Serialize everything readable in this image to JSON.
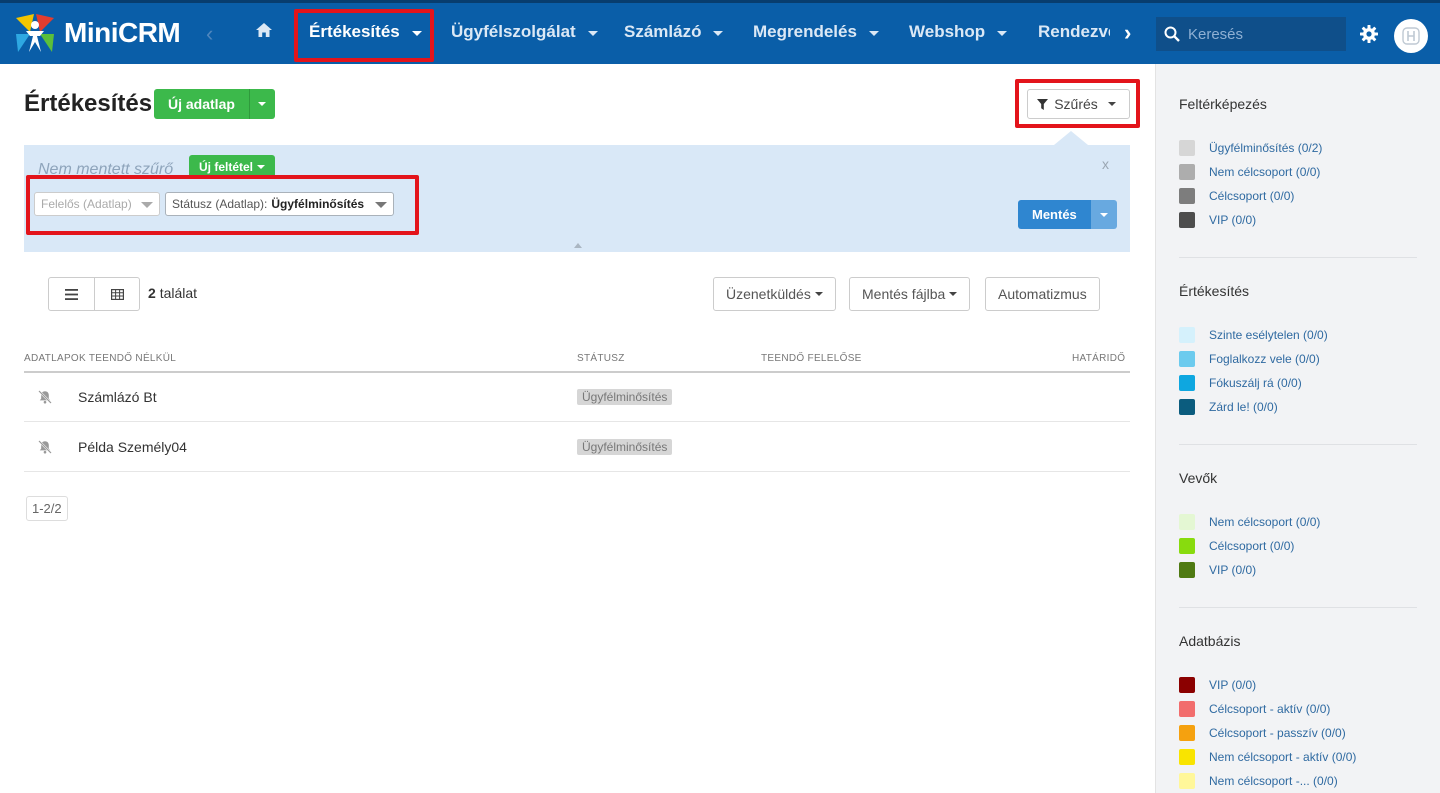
{
  "app": {
    "name": "MiniCRM"
  },
  "nav": {
    "items": [
      {
        "label": "Értékesítés",
        "active": true
      },
      {
        "label": "Ügyfélszolgálat"
      },
      {
        "label": "Számlázó"
      },
      {
        "label": "Megrendelés"
      },
      {
        "label": "Webshop"
      },
      {
        "label": "Rendezvé"
      }
    ],
    "search_placeholder": "Keresés"
  },
  "page": {
    "title": "Értékesítés",
    "new_button": "Új adatlap",
    "filter_button": "Szűrés"
  },
  "filter_panel": {
    "unsaved_label": "Nem mentett szűrő",
    "new_condition_button": "Új feltétel",
    "close_label": "x",
    "selects": [
      {
        "label": "Felelős (Adatlap)",
        "value": ""
      },
      {
        "label": "Státusz (Adatlap):",
        "value": "Ügyfélminősítés"
      }
    ],
    "save_button": "Mentés"
  },
  "toolbar": {
    "result_count": "2",
    "result_label": "találat",
    "buttons": [
      "Üzenetküldés",
      "Mentés fájlba",
      "Automatizmus"
    ]
  },
  "table": {
    "headers": [
      "ADATLAPOK TEENDŐ NÉLKÜL",
      "STÁTUSZ",
      "TEENDŐ FELELŐSE",
      "HATÁRIDŐ"
    ],
    "rows": [
      {
        "name": "Számlázó Bt",
        "status": "Ügyfélminősítés"
      },
      {
        "name": "Példa Személy04",
        "status": "Ügyfélminősítés"
      }
    ]
  },
  "pager": {
    "text": "1-2/2"
  },
  "sidebar": {
    "groups": [
      {
        "title": "Feltérképezés",
        "items": [
          {
            "label": "Ügyfélminősítés (0/2)",
            "color": "#d6d6d6"
          },
          {
            "label": "Nem célcsoport (0/0)",
            "color": "#adadad"
          },
          {
            "label": "Célcsoport (0/0)",
            "color": "#7d7d7d"
          },
          {
            "label": "VIP (0/0)",
            "color": "#4d4d4d"
          }
        ]
      },
      {
        "title": "Értékesítés",
        "items": [
          {
            "label": "Szinte esélytelen (0/0)",
            "color": "#d5f1fc"
          },
          {
            "label": "Foglalkozz vele (0/0)",
            "color": "#6ccbee"
          },
          {
            "label": "Fókuszálj rá (0/0)",
            "color": "#0ea7e0"
          },
          {
            "label": "Zárd le! (0/0)",
            "color": "#0b5c7e"
          }
        ]
      },
      {
        "title": "Vevők",
        "items": [
          {
            "label": "Nem célcsoport (0/0)",
            "color": "#e4f7d3"
          },
          {
            "label": "Célcsoport (0/0)",
            "color": "#88db0e"
          },
          {
            "label": "VIP (0/0)",
            "color": "#4f7a12"
          }
        ]
      },
      {
        "title": "Adatbázis",
        "items": [
          {
            "label": "VIP (0/0)",
            "color": "#8b0000"
          },
          {
            "label": "Célcsoport - aktív (0/0)",
            "color": "#f26d6d"
          },
          {
            "label": "Célcsoport - passzív (0/0)",
            "color": "#f5a10f"
          },
          {
            "label": "Nem célcsoport - aktív (0/0)",
            "color": "#f9e400"
          },
          {
            "label": "Nem célcsoport -... (0/0)",
            "color": "#fff79a"
          }
        ]
      }
    ]
  }
}
